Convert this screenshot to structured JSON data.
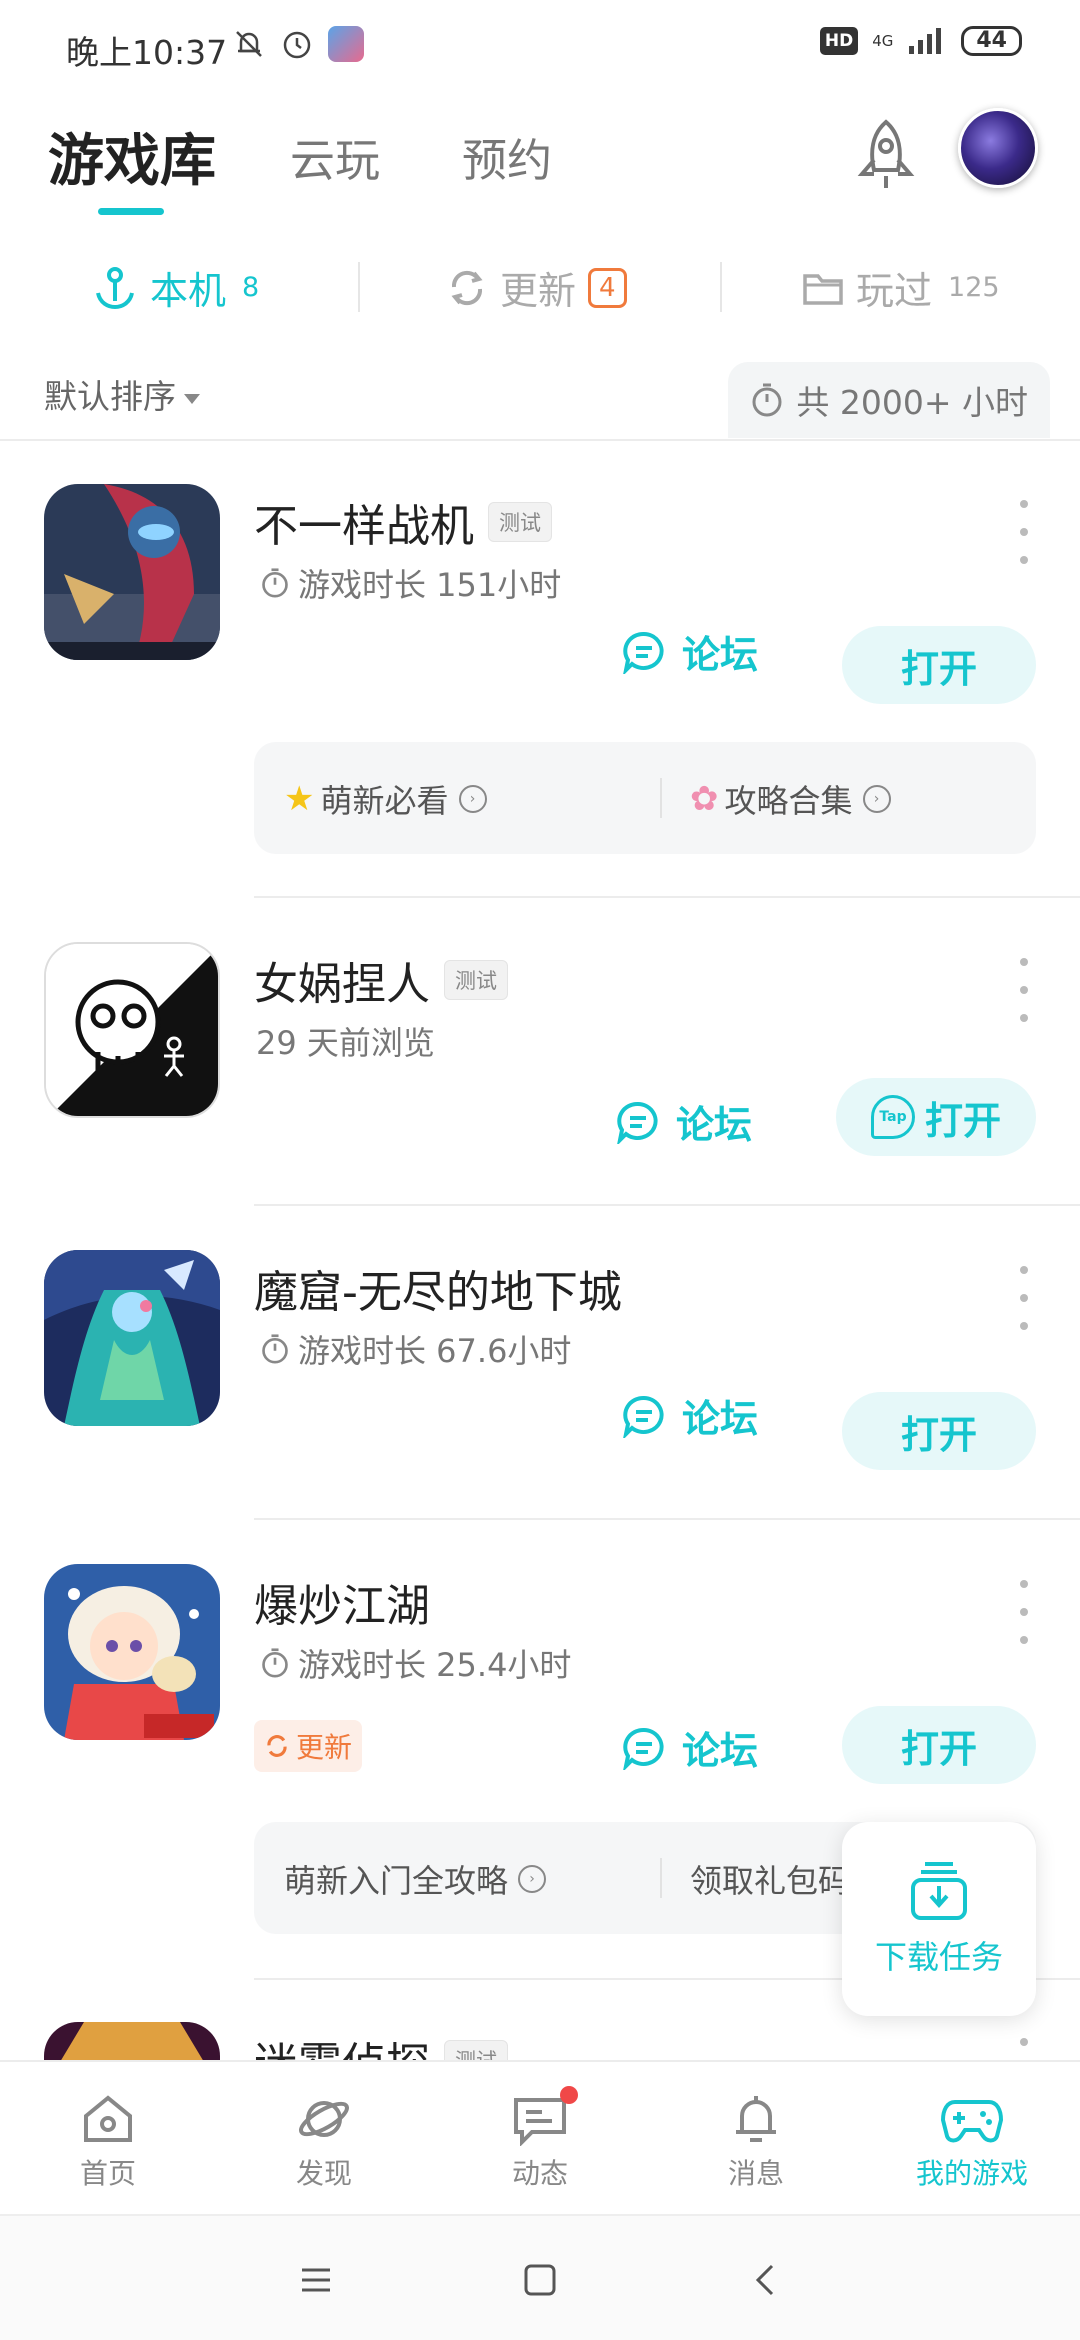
{
  "status_bar": {
    "time": "晚上10:37",
    "hd": "HD",
    "network": "4G",
    "battery": "44"
  },
  "header": {
    "tabs": [
      {
        "label": "游戏库",
        "active": true
      },
      {
        "label": "云玩",
        "active": false
      },
      {
        "label": "预约",
        "active": false
      }
    ]
  },
  "subtabs": [
    {
      "label": "本机",
      "count": "8",
      "active": true
    },
    {
      "label": "更新",
      "count": "4",
      "active": false
    },
    {
      "label": "玩过",
      "count": "125",
      "active": false
    }
  ],
  "sort": {
    "label": "默认排序",
    "total_playtime": "共 2000+ 小时"
  },
  "games": [
    {
      "name": "不一样战机",
      "badge": "测试",
      "meta": "游戏时长 151小时",
      "forum_label": "论坛",
      "open_label": "打开",
      "guides": [
        {
          "label": "萌新必看"
        },
        {
          "label": "攻略合集"
        }
      ]
    },
    {
      "name": "女娲捏人",
      "badge": "测试",
      "meta": "29 天前浏览",
      "forum_label": "论坛",
      "open_label": "打开",
      "open_icon_text": "Tap"
    },
    {
      "name": "魔窟-无尽的地下城",
      "meta": "游戏时长 67.6小时",
      "forum_label": "论坛",
      "open_label": "打开"
    },
    {
      "name": "爆炒江湖",
      "meta": "游戏时长 25.4小时",
      "update_tag": "更新",
      "forum_label": "论坛",
      "open_label": "打开",
      "guides": [
        {
          "label": "萌新入门全攻略"
        },
        {
          "label": "领取礼包码"
        }
      ]
    },
    {
      "name": "迷雾侦探",
      "badge": "测试"
    }
  ],
  "download_fab": {
    "label": "下载任务"
  },
  "bottom_nav": [
    {
      "label": "首页",
      "icon": "home-icon"
    },
    {
      "label": "发现",
      "icon": "planet-icon"
    },
    {
      "label": "动态",
      "icon": "chat-icon",
      "dot": true
    },
    {
      "label": "消息",
      "icon": "bell-icon"
    },
    {
      "label": "我的游戏",
      "icon": "gamepad-icon",
      "active": true
    }
  ],
  "colors": {
    "accent": "#15c5ce",
    "update": "#f07a3c",
    "notify": "#f04848"
  }
}
